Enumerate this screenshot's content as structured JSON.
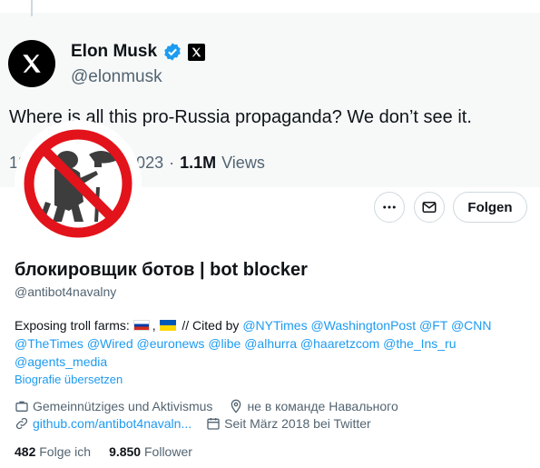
{
  "tweet": {
    "author_name": "Elon Musk",
    "author_handle": "@elonmusk",
    "text": "Where is all this pro-Russia propaganda? We don’t see it.",
    "date_visible": "12",
    "date_partial": "3, 2023",
    "separator": "·",
    "views_count": "1.1M",
    "views_label": "Views"
  },
  "profile": {
    "follow_label": "Folgen",
    "name": "блокировщик ботов | bot blocker",
    "handle": "@antibot4navalny",
    "bio_prefix": "Exposing troll farms:",
    "bio_cited": "// Cited by",
    "mentions": [
      "@NYTimes",
      "@WashingtonPost",
      "@FT",
      "@CNN",
      "@TheTimes",
      "@Wired",
      "@euronews",
      "@libe",
      "@alhurra",
      "@haaretzcom",
      "@the_Ins_ru",
      "@agents_media"
    ],
    "translate_label": "Biografie übersetzen",
    "category": "Gemeinnütziges und Aktivismus",
    "location": "не в команде Навального",
    "website": "github.com/antibot4navaln...",
    "joined": "Seit März 2018 bei Twitter",
    "following_count": "482",
    "following_label": "Folge ich",
    "followers_count": "9.850",
    "followers_label": "Follower"
  },
  "colors": {
    "accent": "#1d9bf0",
    "muted": "#536471",
    "ban_red": "#e3131b"
  },
  "icons": [
    "x-logo-icon",
    "verified-icon",
    "more-icon",
    "mail-icon",
    "briefcase-icon",
    "location-icon",
    "link-icon",
    "calendar-icon"
  ]
}
